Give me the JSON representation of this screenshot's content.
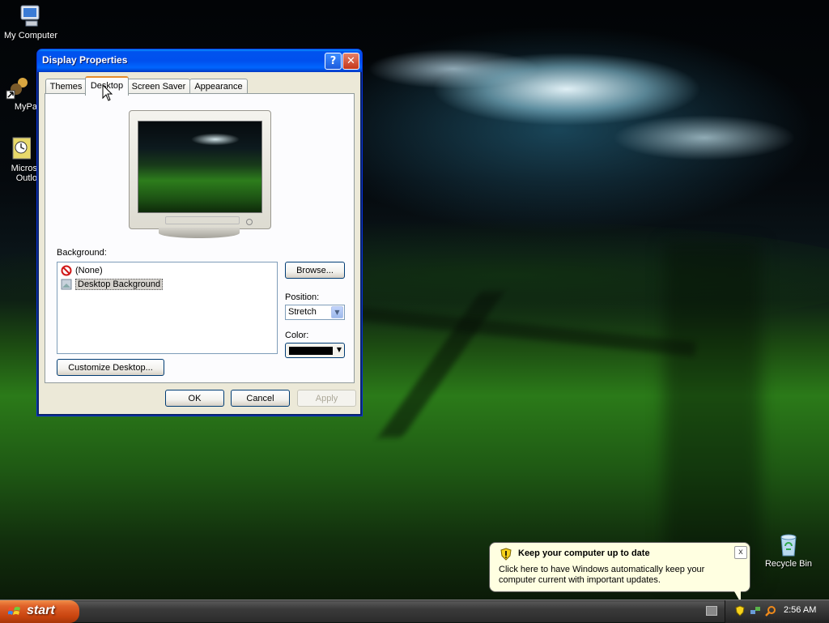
{
  "desktop": {
    "icons": [
      {
        "label": "My Computer"
      },
      {
        "label": "MyPa"
      },
      {
        "label": "Micros\nOutlo"
      },
      {
        "label": "Recycle Bin"
      }
    ]
  },
  "dialog": {
    "title": "Display Properties",
    "help_glyph": "?",
    "close_glyph": "✕",
    "tabs": [
      {
        "label": "Themes"
      },
      {
        "label": "Desktop",
        "active": true
      },
      {
        "label": "Screen Saver"
      },
      {
        "label": "Appearance"
      }
    ],
    "background_label": "Background:",
    "background_items": [
      {
        "label": "(None)",
        "icon": "none-icon"
      },
      {
        "label": "Desktop Background",
        "icon": "image-file-icon",
        "selected": true
      }
    ],
    "browse_label": "Browse...",
    "position_label": "Position:",
    "position_value": "Stretch",
    "color_label": "Color:",
    "color_value": "#000000",
    "customize_label": "Customize Desktop...",
    "ok_label": "OK",
    "cancel_label": "Cancel",
    "apply_label": "Apply"
  },
  "taskbar": {
    "start_label": "start",
    "clock": "2:56 AM"
  },
  "balloon": {
    "title": "Keep your computer up to date",
    "text": "Click here to have Windows automatically keep your computer current with important updates.",
    "close_glyph": "x"
  },
  "colors": {
    "title_bar": "#0054e3",
    "dialog_face": "#ece9d8",
    "start_button": "#e0622a",
    "balloon_bg": "#ffffe1"
  }
}
